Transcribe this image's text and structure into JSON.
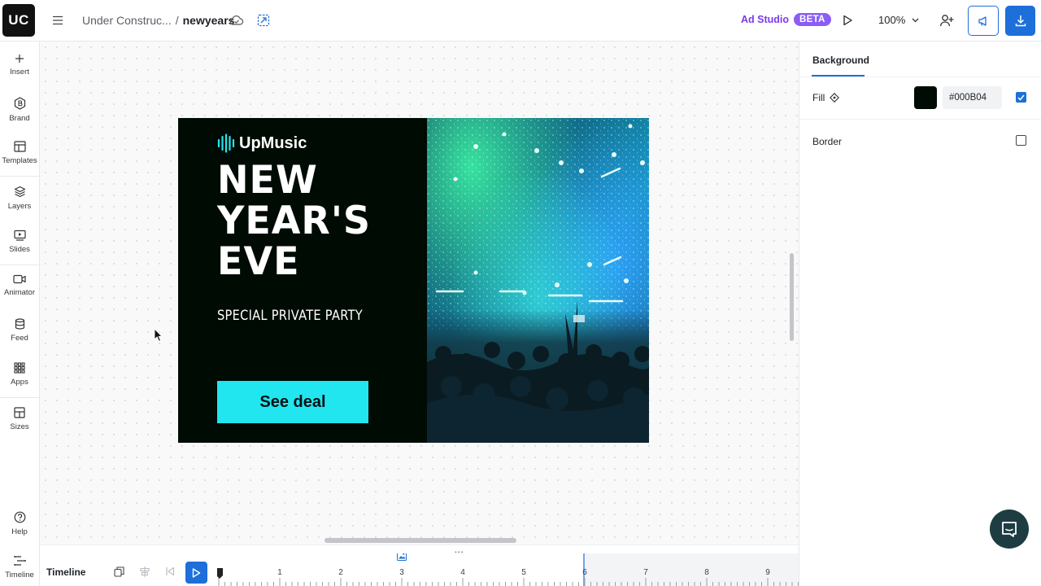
{
  "app": {
    "logo_text": "UC",
    "breadcrumb": {
      "project": "Under Construc...",
      "separator": "/",
      "current": "newyears"
    }
  },
  "topbar": {
    "ad_studio_label": "Ad Studio",
    "beta_badge": "BETA",
    "zoom_value": "100%"
  },
  "sidebar": {
    "items": [
      {
        "label": "Insert",
        "icon": "plus-icon"
      },
      {
        "label": "Brand",
        "icon": "brand-icon"
      },
      {
        "label": "Templates",
        "icon": "templates-icon"
      },
      {
        "label": "Layers",
        "icon": "layers-icon"
      },
      {
        "label": "Slides",
        "icon": "slides-icon"
      },
      {
        "label": "Animator",
        "icon": "video-icon"
      },
      {
        "label": "Feed",
        "icon": "database-icon"
      },
      {
        "label": "Apps",
        "icon": "grid-icon"
      },
      {
        "label": "Sizes",
        "icon": "sizes-icon"
      }
    ],
    "bottom": [
      {
        "label": "Help",
        "icon": "help-icon"
      },
      {
        "label": "Timeline",
        "icon": "timeline-icon"
      }
    ]
  },
  "ad": {
    "brand_name": "UpMusic",
    "headline": [
      "NEW",
      "YEAR'S",
      "EVE"
    ],
    "subline": "SPECIAL PRIVATE PARTY",
    "cta_label": "See deal",
    "background_color": "#000B04",
    "cta_color": "#21E6EF"
  },
  "right_panel": {
    "tab_label": "Background",
    "fill_label": "Fill",
    "fill_hex": "#000B04",
    "fill_enabled": true,
    "border_label": "Border",
    "border_enabled": false
  },
  "timeline": {
    "label": "Timeline",
    "ticks": [
      "1",
      "2",
      "3",
      "4",
      "5",
      "6",
      "7",
      "8",
      "9"
    ]
  },
  "colors": {
    "accent": "#1E6FD9",
    "beta": "#8B5CF6"
  }
}
